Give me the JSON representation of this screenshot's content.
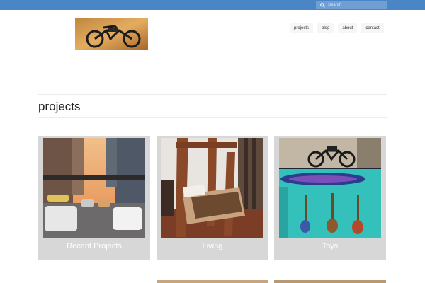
{
  "search": {
    "placeholder": "Search"
  },
  "nav": {
    "items": [
      "projects",
      "blog",
      "about",
      "contact"
    ]
  },
  "page": {
    "title": "projects"
  },
  "cards": [
    {
      "label": "Recent Projects"
    },
    {
      "label": "Living"
    },
    {
      "label": "Toys"
    }
  ],
  "colors": {
    "topbar": "#4a86c5",
    "card_bg": "#d7d7d7"
  }
}
